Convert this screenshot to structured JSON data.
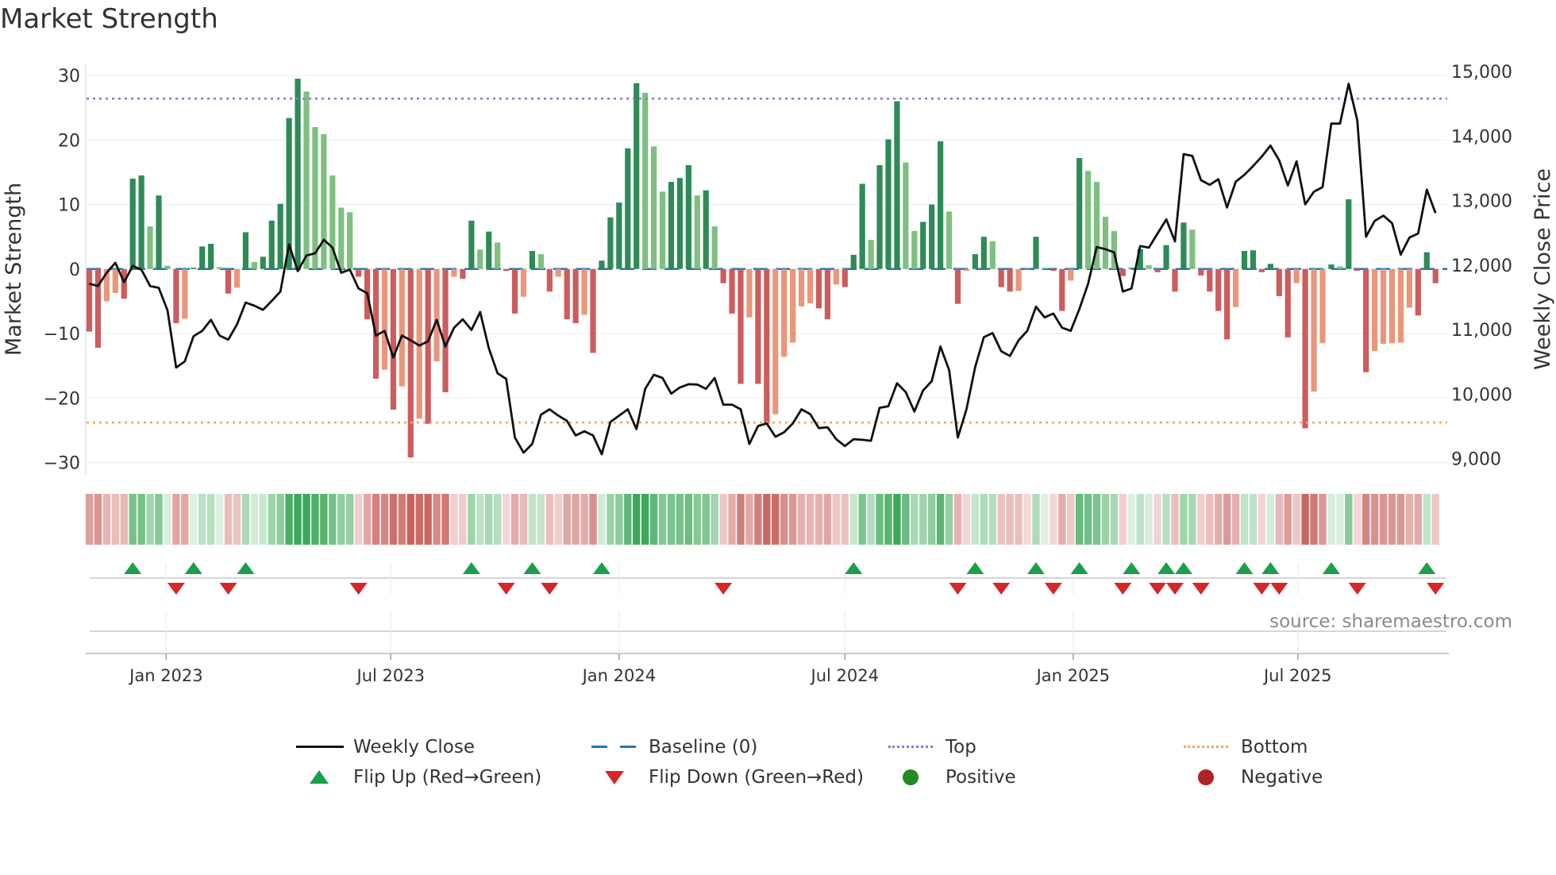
{
  "title": "Market Strength",
  "source": "source: sharemaestro.com",
  "chart_data": {
    "type": "bar",
    "title": "Market Strength",
    "x": {
      "start_week": "2022-10-31",
      "interval_days": 7,
      "ticks": [
        {
          "date": "2023-01-01",
          "label": "Jan 2023"
        },
        {
          "date": "2023-07-01",
          "label": "Jul 2023"
        },
        {
          "date": "2024-01-01",
          "label": "Jan 2024"
        },
        {
          "date": "2024-07-01",
          "label": "Jul 2024"
        },
        {
          "date": "2025-01-01",
          "label": "Jan 2025"
        },
        {
          "date": "2025-07-01",
          "label": "Jul 2025"
        }
      ]
    },
    "left_axis": {
      "label": "Market Strength",
      "range": [
        -31.9,
        31.6
      ],
      "ticks": [
        30,
        20,
        10,
        0,
        -10,
        -20,
        -30
      ],
      "tick_labels": [
        "30",
        "20",
        "10",
        "0",
        "−10",
        "−20",
        "−30"
      ]
    },
    "right_axis": {
      "label": "Weekly Close Price",
      "range": [
        8810,
        15160
      ],
      "ticks": [
        15000,
        14000,
        13000,
        12000,
        11000,
        10000,
        9000
      ],
      "tick_labels": [
        "15,000",
        "14,000",
        "13,000",
        "12,000",
        "11,000",
        "10,000",
        "9,000"
      ]
    },
    "series": [
      {
        "name": "Market Strength",
        "type": "bar",
        "values": [
          -9.7,
          -12.2,
          -5,
          -3.7,
          -4.6,
          14,
          14.5,
          6.6,
          11.4,
          0.5,
          -8.4,
          -7.7,
          0.2,
          3.5,
          3.9,
          0.3,
          -3.8,
          -2.9,
          5.7,
          1.1,
          1.9,
          7.5,
          10.1,
          23.4,
          29.5,
          27.5,
          22,
          20.9,
          14.5,
          9.5,
          8.8,
          -1.2,
          -7.8,
          -17,
          -15.6,
          -21.8,
          -18.2,
          -29.2,
          -23.2,
          -24,
          -14.3,
          -19.1,
          -1.2,
          -1.5,
          7.5,
          3,
          5.8,
          4.1,
          -0.3,
          -6.9,
          -4.3,
          2.8,
          2.3,
          -3.5,
          -1.2,
          -7.8,
          -8.4,
          -7.1,
          -13,
          1.3,
          8,
          10.3,
          18.7,
          28.8,
          27.3,
          19,
          12,
          13.5,
          14.1,
          16.1,
          11.4,
          12.2,
          6.6,
          -2.2,
          -6.9,
          -17.8,
          -7.5,
          -17.8,
          -24,
          -22.5,
          -13.6,
          -11.4,
          -5.8,
          -5.3,
          -6.1,
          -7.8,
          -2.4,
          -2.8,
          2.2,
          13.2,
          4.5,
          16.1,
          20.1,
          26,
          16.5,
          5.9,
          7.3,
          10,
          19.8,
          8.9,
          -5.4,
          -0.3,
          2.3,
          5,
          4.3,
          -2.8,
          -3.5,
          -3.4,
          -0.1,
          5,
          0.1,
          -0.3,
          -6.5,
          -1.8,
          17.2,
          15.2,
          13.5,
          8.1,
          5.9,
          -1.1,
          0.2,
          3.1,
          0.6,
          -0.5,
          3.7,
          -3.5,
          7.2,
          6.1,
          -1,
          -3.5,
          -6.5,
          -10.9,
          -5.9,
          2.8,
          2.9,
          -0.5,
          0.8,
          -4.2,
          -10.6,
          -2.2,
          -24.7,
          -19,
          -11.5,
          0.7,
          0.4,
          10.8,
          -0.3,
          -16,
          -12.7,
          -11.6,
          -11.5,
          -11.4,
          -6,
          -7.2,
          2.6,
          -2.2
        ]
      },
      {
        "name": "Weekly Close",
        "type": "line",
        "axis": "right",
        "values": [
          11771,
          11737,
          11942,
          12097,
          11796,
          12049,
          11990,
          11737,
          11708,
          11358,
          10472,
          10569,
          10959,
          11041,
          11212,
          10968,
          10905,
          11139,
          11479,
          11431,
          11367,
          11504,
          11650,
          12380,
          11966,
          12209,
          12243,
          12453,
          12331,
          11942,
          11990,
          11698,
          11625,
          10968,
          11041,
          10628,
          10968,
          10895,
          10813,
          10881,
          11212,
          10798,
          11090,
          11221,
          11056,
          11333,
          10774,
          10384,
          10297,
          9387,
          9153,
          9289,
          9742,
          9825,
          9727,
          9645,
          9421,
          9484,
          9421,
          9129,
          9630,
          9727,
          9825,
          9518,
          10141,
          10360,
          10311,
          10068,
          10165,
          10214,
          10209,
          10141,
          10311,
          9898,
          9898,
          9825,
          9289,
          9567,
          9606,
          9400,
          9470,
          9606,
          9825,
          9752,
          9533,
          9547,
          9363,
          9255,
          9363,
          9353,
          9338,
          9849,
          9873,
          10229,
          10092,
          9791,
          10117,
          10263,
          10798,
          10433,
          9387,
          9825,
          10482,
          10944,
          11007,
          10725,
          10652,
          10895,
          11041,
          11416,
          11250,
          11309,
          11090,
          11041,
          11382,
          11771,
          12341,
          12307,
          12258,
          11650,
          11698,
          12355,
          12331,
          12550,
          12769,
          12428,
          13781,
          13752,
          13377,
          13304,
          13392,
          12954,
          13353,
          13460,
          13596,
          13742,
          13912,
          13684,
          13294,
          13669,
          13002,
          13197,
          13270,
          14253,
          14253,
          14871,
          14302,
          12501,
          12745,
          12827,
          12710,
          12224,
          12487,
          12550,
          13231,
          12866
        ]
      }
    ],
    "reference_lines": {
      "top": 26.4,
      "bottom": -23.8,
      "baseline": 0
    },
    "grid": true,
    "legend_placement": "bottom",
    "legend": [
      {
        "label": "Weekly Close",
        "symbol": "solid-line"
      },
      {
        "label": "Baseline (0)",
        "symbol": "dashed-line"
      },
      {
        "label": "Top",
        "symbol": "dotted-line-purple"
      },
      {
        "label": "Bottom",
        "symbol": "dotted-line-orange"
      },
      {
        "label": "Flip Up (Red→Green)",
        "symbol": "triangle-up"
      },
      {
        "label": "Flip Down (Green→Red)",
        "symbol": "triangle-down"
      },
      {
        "label": "Positive",
        "symbol": "circle-green"
      },
      {
        "label": "Negative",
        "symbol": "circle-red"
      }
    ],
    "colors": {
      "pos_strong": "#2e8b57",
      "pos_weak": "#7fbf7f",
      "neg_strong": "#cd5c5c",
      "neg_weak": "#e9967a",
      "line": "#111111",
      "baseline": "#1f77b4",
      "top": "#9370db",
      "bottom": "#f4a460",
      "flip_up": "#1a9f4a",
      "flip_down": "#d62728",
      "positive": "#228b22",
      "negative": "#b22222"
    }
  }
}
